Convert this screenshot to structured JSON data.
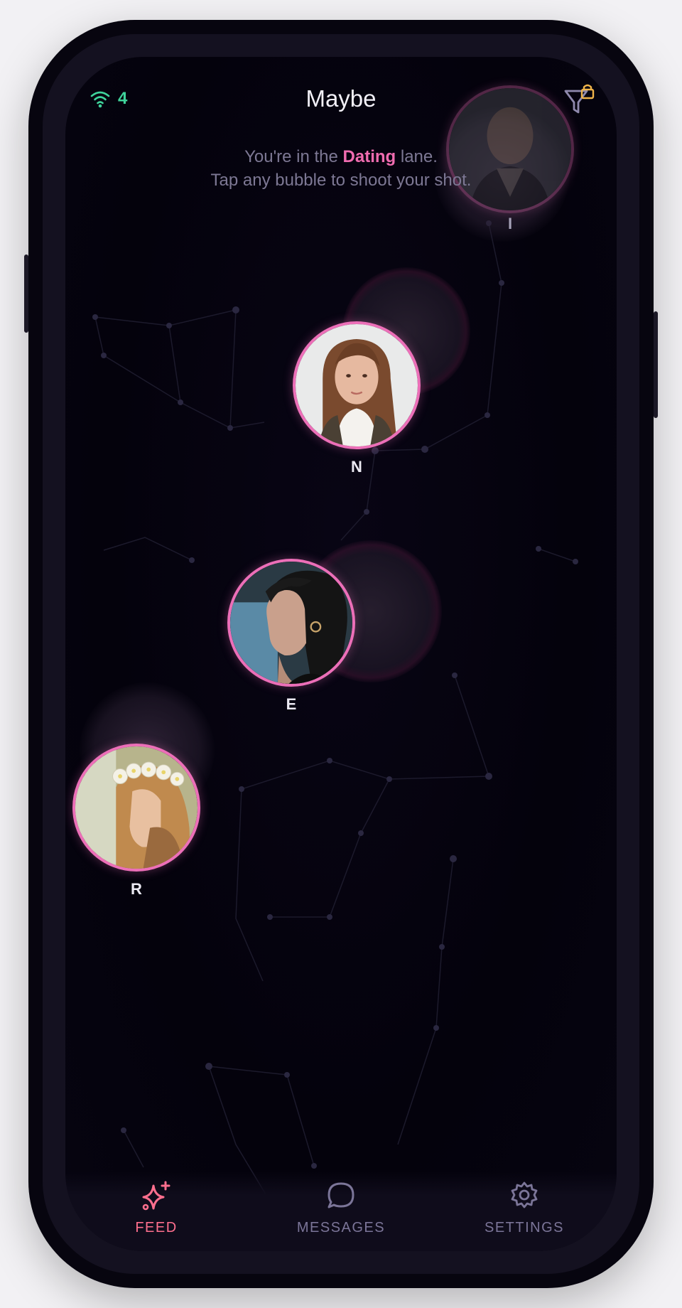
{
  "header": {
    "title": "Maybe",
    "signal_count": "4",
    "signal_icon": "wifi-icon",
    "filter_icon": "filter-locked-icon"
  },
  "intro": {
    "line1_prefix": "You're in the ",
    "lane_name": "Dating",
    "line1_suffix": " lane.",
    "line2": "Tap any bubble to shoot your shot."
  },
  "bubbles": [
    {
      "name": "I",
      "photo": "man-in-dark-jacket"
    },
    {
      "name": "N",
      "photo": "woman-long-brown-hair-white-scarf"
    },
    {
      "name": "E",
      "photo": "woman-short-dark-hair-profile"
    },
    {
      "name": "R",
      "photo": "woman-flower-crown"
    }
  ],
  "tabs": [
    {
      "label": "FEED",
      "icon": "sparkles-icon",
      "active": true
    },
    {
      "label": "MESSAGES",
      "icon": "chat-bubble-icon",
      "active": false
    },
    {
      "label": "SETTINGS",
      "icon": "gear-icon",
      "active": false
    }
  ],
  "colors": {
    "accent_pink": "#ec6fb8",
    "active_tab": "#ff6f8e",
    "signal_green": "#3fd39b",
    "lock_amber": "#f0b44a",
    "background": "#04020c"
  }
}
